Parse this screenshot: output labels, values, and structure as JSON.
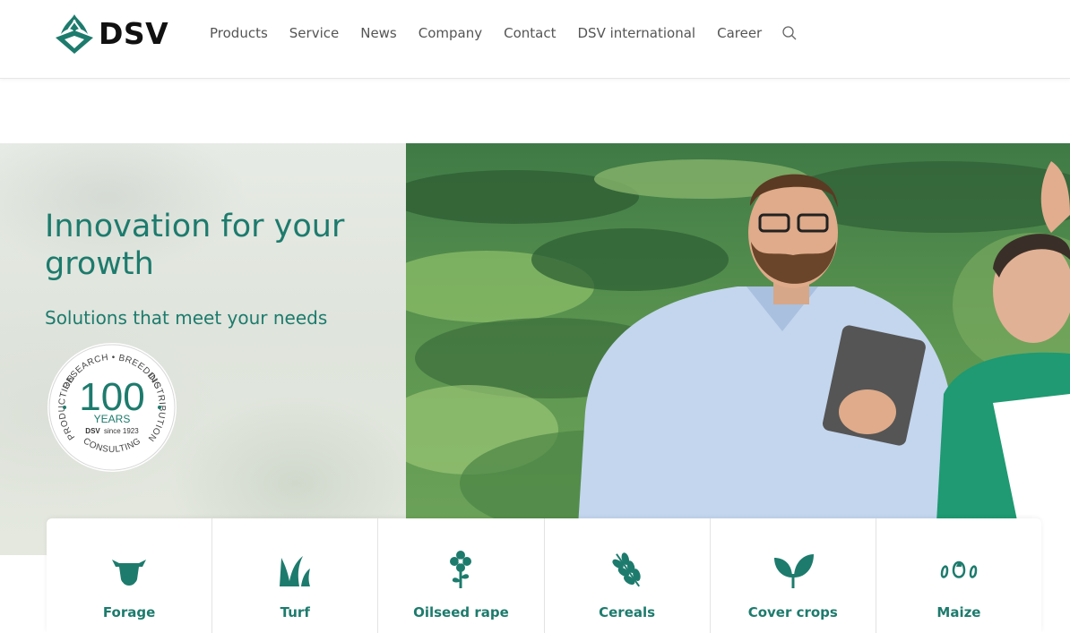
{
  "brand": {
    "name": "DSV",
    "accent": "#1d7b6d"
  },
  "nav": {
    "items": [
      "Products",
      "Service",
      "News",
      "Company",
      "Contact",
      "DSV international",
      "Career"
    ],
    "search_icon": "search-icon"
  },
  "hero": {
    "title": "Innovation for your growth",
    "subtitle": "Solutions that meet your needs",
    "badge": {
      "top_text": "RESEARCH • BREEDING",
      "right_text": "DISTRIBUTION",
      "bottom_text": "CONSULTING",
      "left_text": "PRODUCTION",
      "number": "100",
      "years": "YEARS",
      "since_brand": "DSV",
      "since": "since 1923"
    }
  },
  "categories": [
    {
      "label": "Forage",
      "icon": "cow-icon"
    },
    {
      "label": "Turf",
      "icon": "grass-icon"
    },
    {
      "label": "Oilseed rape",
      "icon": "flower-icon"
    },
    {
      "label": "Cereals",
      "icon": "wheat-icon"
    },
    {
      "label": "Cover crops",
      "icon": "leaves-icon"
    },
    {
      "label": "Maize",
      "icon": "maize-icon"
    }
  ]
}
